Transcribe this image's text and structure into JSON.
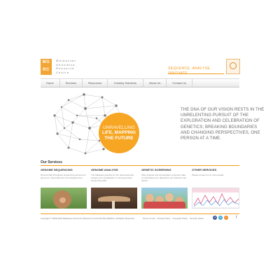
{
  "header": {
    "logo_lines": [
      "MG",
      "RC"
    ],
    "name_lines": [
      "Malaysian",
      "Genomics",
      "Resource",
      "Centre"
    ],
    "tagline": "SEQUENCE. ANALYSE. INNOVATE"
  },
  "nav": {
    "items": [
      {
        "label": "Home"
      },
      {
        "label": "Services"
      },
      {
        "label": "Resources"
      },
      {
        "label": "Industry Solutions"
      },
      {
        "label": "About Us"
      },
      {
        "label": "Contact Us"
      }
    ]
  },
  "hero": {
    "circle_line1": "UNRAVELLING",
    "circle_line2": "LIFE, MAPPING",
    "circle_line3": "THE FUTURE",
    "statement": "THE DNA OF OUR VISION RESTS IN THE UNRELENTING PURSUIT OF THE EXPLORATION AND CELEBRATION OF GENETICS; BREAKING BOUNDARIES AND CHANGING PERSPECTIVES, ONE PERSON AT A TIME."
  },
  "services": {
    "title": "Our Services",
    "items": [
      {
        "heading": "GENOME SEQUENCING",
        "description": "Illumina high-throughput sequencing services for genomes, transcriptomes and metagenomes."
      },
      {
        "heading": "GENOME ANALYSIS",
        "description": "The Malaysian pipeline for the rapid assembly, analysis and visualisation of next-generation sequencing data."
      },
      {
        "heading": "GENETIC SCREENING",
        "description": "Offer analysis and interpretation of genetic data to understand your disposition and wellness risk factors."
      },
      {
        "heading": "OTHER SERVICES",
        "description": "Please contact us for more details."
      }
    ]
  },
  "footer": {
    "copyright": "Copyright © 2009-2010 Malaysian Genomics Resource Centre Berhad (MGRC). All Rights Reserved.",
    "links": [
      {
        "label": "Terms of Use"
      },
      {
        "label": "Privacy Policy"
      },
      {
        "label": "Copyright Policy"
      },
      {
        "label": "Security Notice"
      }
    ],
    "social": {
      "facebook": "f",
      "twitter": "t",
      "rss": "r"
    }
  },
  "colors": {
    "accent": "#f29b1e",
    "circle": "#f6a623"
  }
}
